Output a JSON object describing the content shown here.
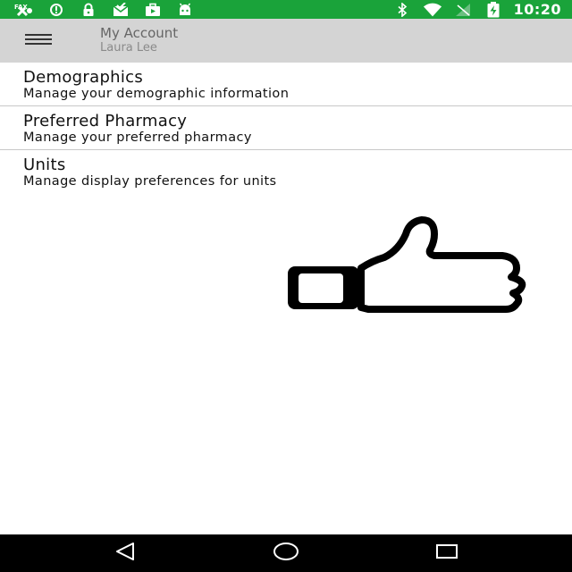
{
  "status_bar": {
    "time": "10:20",
    "left_icons": [
      "fax-icon",
      "alert-icon",
      "lock-icon",
      "mail-icon",
      "briefcase-icon",
      "android-icon"
    ],
    "right_icons": [
      "bluetooth-icon",
      "wifi-icon",
      "signal-icon",
      "battery-charging-icon"
    ],
    "background": "#1aa33a"
  },
  "app_bar": {
    "title": "My Account",
    "subtitle": "Laura Lee",
    "menu_icon": "hamburger-menu-icon",
    "background": "#d4d4d4"
  },
  "list": {
    "items": [
      {
        "title": "Demographics",
        "subtitle": "Manage your demographic information"
      },
      {
        "title": "Preferred Pharmacy",
        "subtitle": "Manage your preferred pharmacy"
      },
      {
        "title": "Units",
        "subtitle": "Manage display preferences for units"
      }
    ]
  },
  "overlay": {
    "icon": "thumbs-up-icon"
  },
  "nav_bar": {
    "buttons": [
      "back-icon",
      "home-icon",
      "recents-icon"
    ],
    "background": "#000000"
  }
}
